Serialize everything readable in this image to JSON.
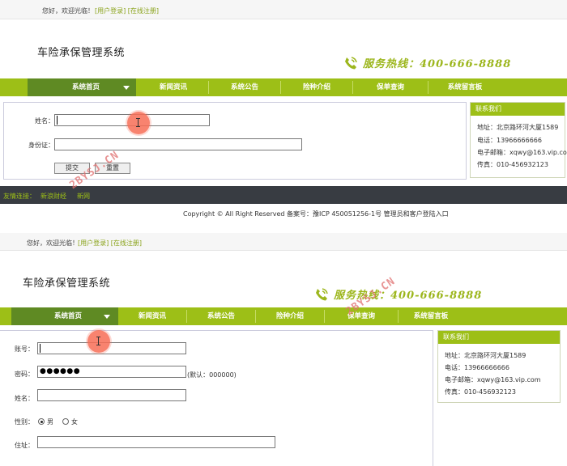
{
  "shot1": {
    "topbar": {
      "greeting": "您好，欢迎光临！",
      "login": "[用户登录]",
      "register": "[在线注册]"
    },
    "site_title": "车险承保管理系统",
    "hotline": {
      "label": "服务热线：400-666-8888",
      "icon": "phone-icon"
    },
    "nav": [
      "系统首页",
      "新闻资讯",
      "系统公告",
      "险种介绍",
      "保单查询",
      "系统留言板"
    ],
    "form": {
      "name_label": "姓名：",
      "name_value": "",
      "idcard_label": "身份证：",
      "idcard_value": "",
      "submit_label": "提交",
      "reset_label": "重置"
    },
    "contact": {
      "title": "联系我们",
      "address": "地址：北京路环河大厦1589",
      "phone": "电话：13966666666",
      "email": "电子邮箱：xqwy@163.vip.com",
      "fax": "传真：010-456932123"
    },
    "friend_links": {
      "label": "友情连接：",
      "link1": "新浪财经",
      "link2": "新网"
    },
    "copyright": "Copyright © All Right Reserved 备案号：豫ICP 450051256-1号    管理员和客户登陆入口",
    "watermark": "2BYSJ.CN"
  },
  "shot2": {
    "topbar": {
      "greeting": "您好，欢迎光临！",
      "login": "[用户登录]",
      "register": "[在线注册]"
    },
    "site_title": "车险承保管理系统",
    "hotline": {
      "label": "服务热线：400-666-8888",
      "icon": "phone-icon"
    },
    "nav": [
      "系统首页",
      "新闻资讯",
      "系统公告",
      "险种介绍",
      "保单查询",
      "系统留言板"
    ],
    "form": {
      "account_label": "账号：",
      "account_value": "",
      "password_label": "密码：",
      "password_value": "●●●●●●",
      "password_hint": "(默认：000000)",
      "name_label": "姓名：",
      "name_value": "",
      "gender_label": "性别：",
      "gender_options": [
        "男",
        "女"
      ],
      "gender_selected": "男",
      "address_label": "住址：",
      "address_value": ""
    },
    "contact": {
      "title": "联系我们",
      "address": "地址：北京路环河大厦1589",
      "phone": "电话：13966666666",
      "email": "电子邮箱：xqwy@163.vip.com",
      "fax": "传真：010-456932123"
    },
    "watermark": "2BYSJ.CN"
  },
  "colors": {
    "accent": "#9dbf17",
    "nav_home": "#5f8a23",
    "footer": "#383c42",
    "click_marker": "#f76d56"
  }
}
